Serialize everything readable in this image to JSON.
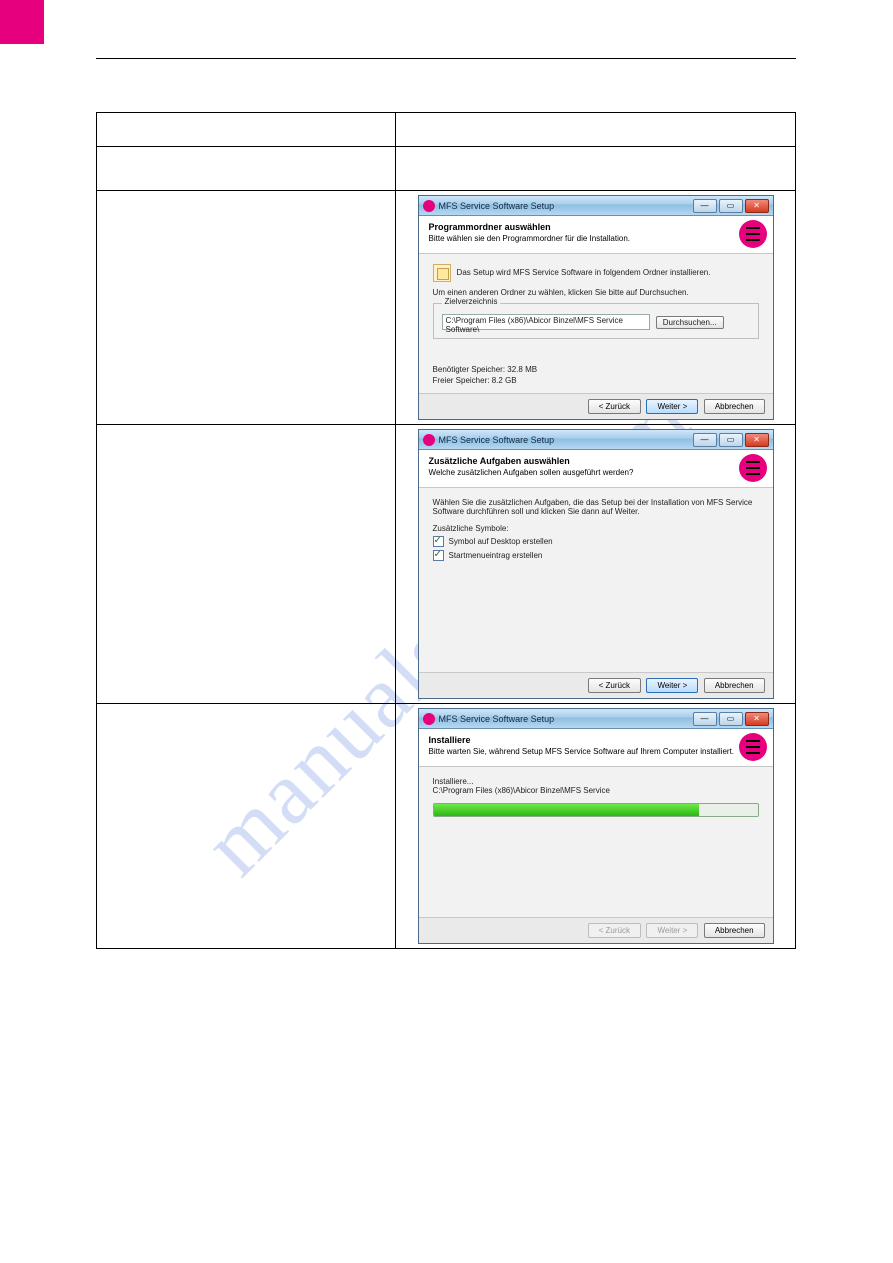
{
  "watermark": "manualslive.com",
  "shots": {
    "s1": {
      "title": "MFS Service Software Setup",
      "hdr_title": "Programmordner auswählen",
      "hdr_sub": "Bitte wählen sie den Programmordner für die Installation.",
      "body_line1": "Das Setup wird MFS Service Software in folgendem Ordner installieren.",
      "body_line2": "Um einen anderen Ordner zu wählen, klicken Sie bitte auf Durchsuchen.",
      "group_label": "Zielverzeichnis",
      "path": "C:\\Program Files (x86)\\Abicor Binzel\\MFS Service Software\\",
      "browse": "Durchsuchen...",
      "req_label": "Benötigter Speicher:",
      "req_val": "32.8 MB",
      "free_label": "Freier Speicher:",
      "free_val": "8.2 GB",
      "back": "< Zurück",
      "next": "Weiter >",
      "cancel": "Abbrechen"
    },
    "s2": {
      "title": "MFS Service Software Setup",
      "hdr_title": "Zusätzliche Aufgaben auswählen",
      "hdr_sub": "Welche zusätzlichen Aufgaben sollen ausgeführt werden?",
      "body_line1": "Wählen Sie die zusätzlichen Aufgaben, die das Setup bei der Installation von MFS Service Software durchführen soll und klicken Sie dann auf Weiter.",
      "sect_label": "Zusätzliche Symbole:",
      "chk1": "Symbol auf Desktop erstellen",
      "chk2": "Startmenueintrag erstellen",
      "back": "< Zurück",
      "next": "Weiter >",
      "cancel": "Abbrechen"
    },
    "s3": {
      "title": "MFS Service Software Setup",
      "hdr_title": "Installiere",
      "hdr_sub": "Bitte warten Sie, während Setup MFS Service Software auf Ihrem Computer installiert.",
      "status_label": "Installiere...",
      "status_path": "C:\\Program Files (x86)\\Abicor Binzel\\MFS Service",
      "back": "< Zurück",
      "next": "Weiter >",
      "cancel": "Abbrechen"
    }
  }
}
